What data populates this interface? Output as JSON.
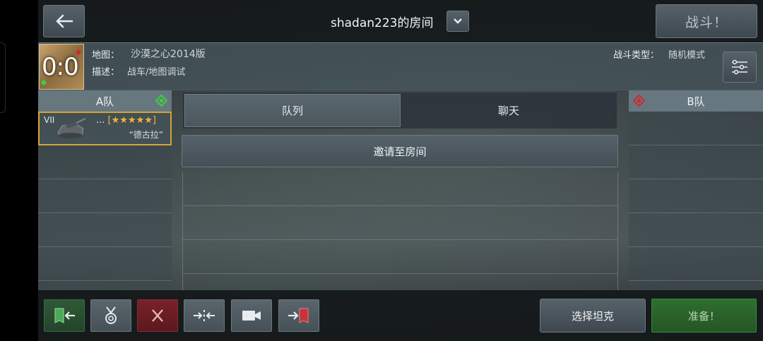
{
  "header": {
    "room_title": "shadan223的房间",
    "battle_label": "战斗！"
  },
  "map_info": {
    "score": "0:0",
    "map_label": "地图：",
    "map_value": "沙漠之心2014版",
    "desc_label": "描述：",
    "desc_value": "战车/地图调试",
    "battle_type_label": "战斗类型：",
    "battle_type_value": "随机模式"
  },
  "team_a": {
    "name": "A队",
    "player": {
      "tier": "VII",
      "name": "...",
      "rating": "[★★★★★]",
      "tank": "“德古拉”"
    }
  },
  "team_b": {
    "name": "B队"
  },
  "tabs": {
    "queue": "队列",
    "chat": "聊天"
  },
  "invite_label": "邀请至房间",
  "footer": {
    "select_tank_label": "选择坦克",
    "ready_label": "准备！"
  },
  "colors": {
    "team_a_accent": "#3fcf3f",
    "team_b_accent": "#d12a2a",
    "selected_slot_border": "#d6a437",
    "stars": "#f0b43a",
    "ready_green": "#2f6e2f"
  },
  "icons": [
    "back-arrow-icon",
    "chevron-down-icon",
    "settings-sliders-icon",
    "join-team-a-icon",
    "medal-icon",
    "close-icon",
    "swap-teams-icon",
    "camera-icon",
    "join-team-b-icon"
  ]
}
